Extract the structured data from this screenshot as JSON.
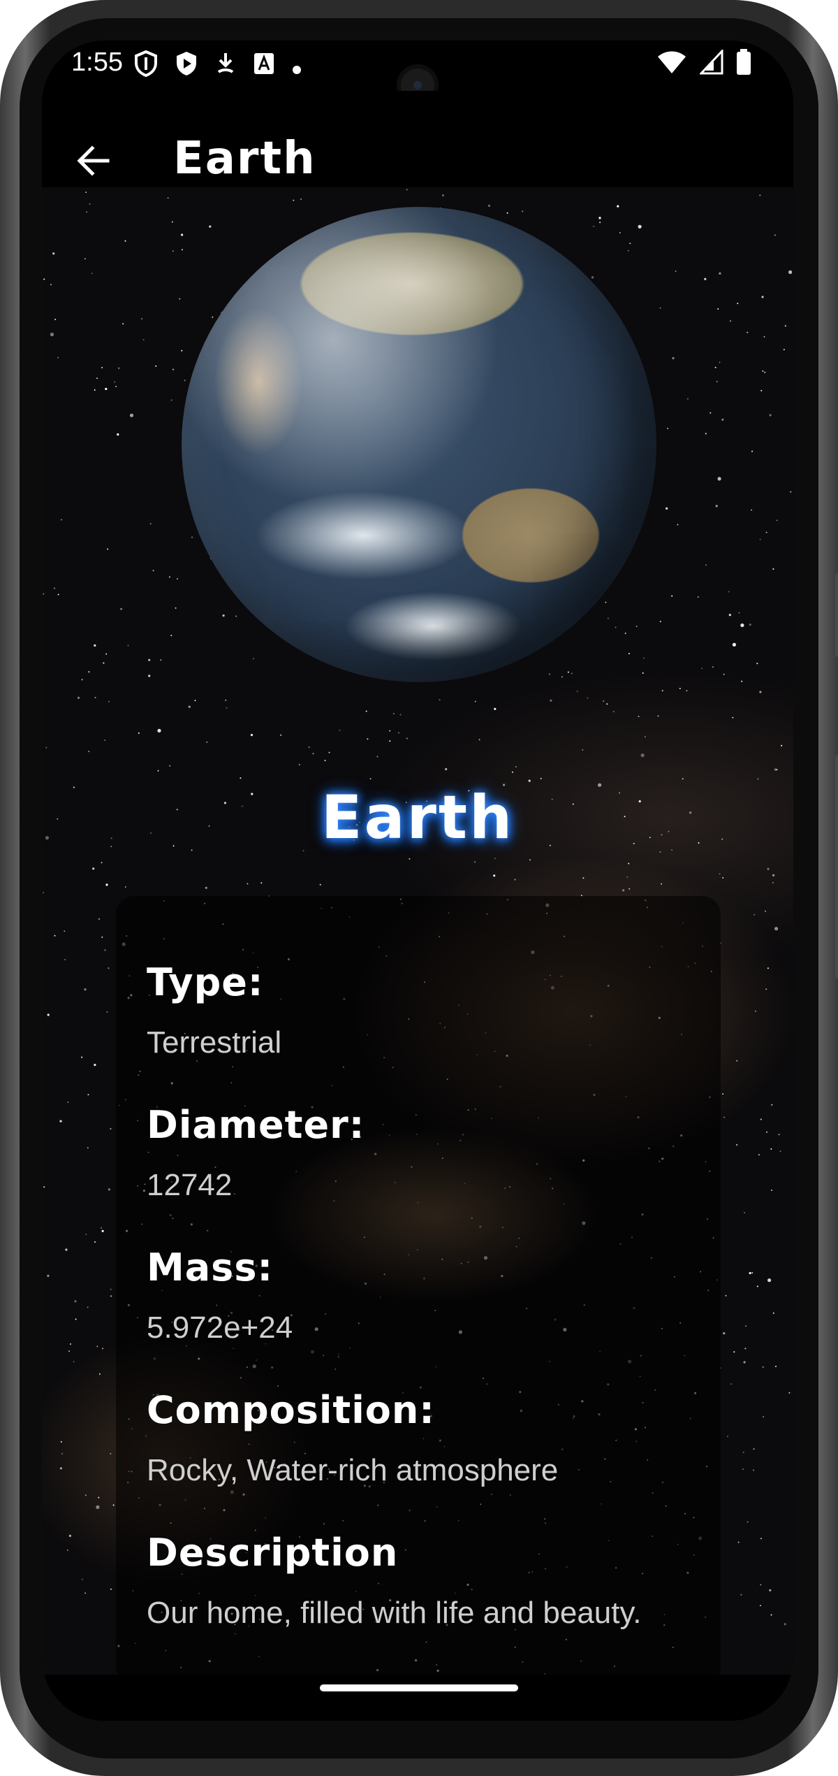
{
  "status_bar": {
    "time": "1:55",
    "left_icons": [
      "shield-outline-icon",
      "play-protect-icon",
      "download-icon",
      "font-a-icon",
      "dot-icon"
    ],
    "right_icons": [
      "wifi-icon",
      "signal-icon",
      "battery-icon"
    ]
  },
  "app_bar": {
    "back_icon": "arrow-left-icon",
    "title": "Earth"
  },
  "hero": {
    "planet_name": "Earth"
  },
  "details": [
    {
      "label": "Type:",
      "value": "Terrestrial"
    },
    {
      "label": "Diameter:",
      "value": "12742"
    },
    {
      "label": "Mass:",
      "value": "5.972e+24"
    },
    {
      "label": "Composition:",
      "value": "Rocky, Water-rich atmosphere"
    },
    {
      "label": "Description",
      "value": "Our home, filled with life and beauty."
    }
  ],
  "colors": {
    "title_glow": "#3b8bff",
    "label": "#ffffff",
    "value": "#cfcfcf",
    "background": "#0b0a0c"
  }
}
